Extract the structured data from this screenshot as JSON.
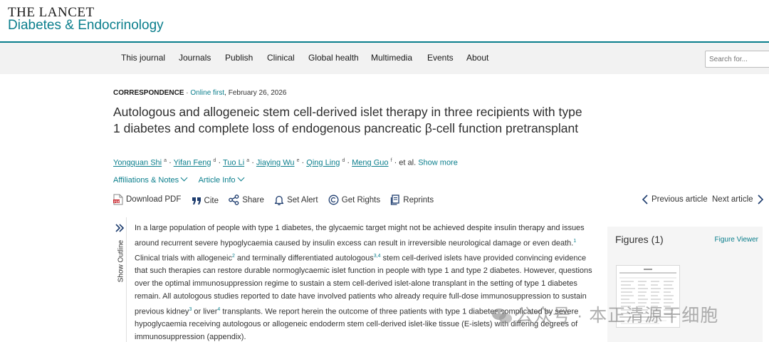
{
  "brand": {
    "top": "THE LANCET",
    "sub": "Diabetes & Endocrinology"
  },
  "nav": {
    "items": [
      "This journal",
      "Journals",
      "Publish",
      "Clinical",
      "Global health",
      "Multimedia",
      "Events",
      "About"
    ],
    "search_placeholder": "Search for..."
  },
  "article": {
    "type": "CORRESPONDENCE",
    "separator": "·",
    "status": "Online first",
    "date": ", February 26, 2026",
    "title": "Autologous and allogeneic stem cell-derived islet therapy in three recipients with type 1 diabetes and complete loss of endogenous pancreatic β-cell function pretransplant",
    "authors": [
      {
        "name": "Yongquan Shi",
        "aff": "a"
      },
      {
        "name": "Yifan Feng",
        "aff": "d"
      },
      {
        "name": "Tuo Li",
        "aff": "a"
      },
      {
        "name": "Jiaying Wu",
        "aff": "e"
      },
      {
        "name": "Qing Ling",
        "aff": "d"
      },
      {
        "name": "Meng Guo",
        "aff": "f"
      }
    ],
    "author_sep": " · ",
    "et_al": " · et al. ",
    "show_more": "Show more",
    "affiliations_label": "Affiliations & Notes",
    "article_info_label": "Article Info"
  },
  "toolbar": {
    "download": "Download PDF",
    "cite": "Cite",
    "share": "Share",
    "alert": "Set Alert",
    "rights": "Get Rights",
    "reprints": "Reprints",
    "prev": "Previous article",
    "next": "Next article"
  },
  "outline": {
    "label": "Show Outline"
  },
  "abstract": {
    "p1": "In a large population of people with type 1 diabetes, the glycaemic target might not be achieved despite insulin therapy and issues around recurrent severe hypoglycaemia caused by insulin excess can result in irreversible neurological damage or even death.",
    "r1": "1",
    "p2": " Clinical trials with allogeneic",
    "r2": "2",
    "p3": " and terminally differentiated autologous",
    "r3": "3,4",
    "p4": " stem cell-derived islets have provided convincing evidence that such therapies can restore durable normoglycaemic islet function in people with type 1 and type 2 diabetes. However, questions over the optimal immunosuppression regime to sustain a stem cell-derived islet-alone transplant in the setting of type 1 diabetes remain. All autologous studies reported to date have involved patients who already require full-dose immunosuppression to sustain previous kidney",
    "r4": "3",
    "p5": " or liver",
    "r5": "4",
    "p6": " transplants. We report herein the outcome of three patients with type 1 diabetes complicated by severe hypoglycaemia receiving autologous or allogeneic endoderm stem cell-derived islet-like tissue (E-islets) with differing degrees of immunosuppression (appendix)."
  },
  "figures": {
    "title": "Figures (1)",
    "viewer": "Figure Viewer"
  },
  "watermark": {
    "text": "公众号 · 本正清源干细胞"
  },
  "colors": {
    "accent": "#0a7e8c",
    "nav_bg": "#f2f2f2",
    "panel_bg": "#f5f5f5",
    "pdf_red": "#c8242b"
  }
}
